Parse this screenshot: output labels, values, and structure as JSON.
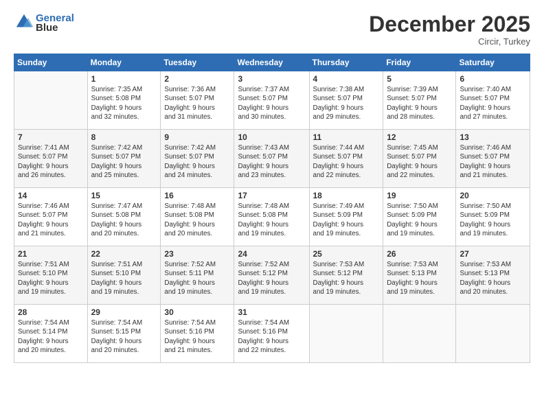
{
  "header": {
    "logo_line1": "General",
    "logo_line2": "Blue",
    "month": "December 2025",
    "location": "Circir, Turkey"
  },
  "weekdays": [
    "Sunday",
    "Monday",
    "Tuesday",
    "Wednesday",
    "Thursday",
    "Friday",
    "Saturday"
  ],
  "weeks": [
    [
      {
        "day": "",
        "info": ""
      },
      {
        "day": "1",
        "info": "Sunrise: 7:35 AM\nSunset: 5:08 PM\nDaylight: 9 hours\nand 32 minutes."
      },
      {
        "day": "2",
        "info": "Sunrise: 7:36 AM\nSunset: 5:07 PM\nDaylight: 9 hours\nand 31 minutes."
      },
      {
        "day": "3",
        "info": "Sunrise: 7:37 AM\nSunset: 5:07 PM\nDaylight: 9 hours\nand 30 minutes."
      },
      {
        "day": "4",
        "info": "Sunrise: 7:38 AM\nSunset: 5:07 PM\nDaylight: 9 hours\nand 29 minutes."
      },
      {
        "day": "5",
        "info": "Sunrise: 7:39 AM\nSunset: 5:07 PM\nDaylight: 9 hours\nand 28 minutes."
      },
      {
        "day": "6",
        "info": "Sunrise: 7:40 AM\nSunset: 5:07 PM\nDaylight: 9 hours\nand 27 minutes."
      }
    ],
    [
      {
        "day": "7",
        "info": "Sunrise: 7:41 AM\nSunset: 5:07 PM\nDaylight: 9 hours\nand 26 minutes."
      },
      {
        "day": "8",
        "info": "Sunrise: 7:42 AM\nSunset: 5:07 PM\nDaylight: 9 hours\nand 25 minutes."
      },
      {
        "day": "9",
        "info": "Sunrise: 7:42 AM\nSunset: 5:07 PM\nDaylight: 9 hours\nand 24 minutes."
      },
      {
        "day": "10",
        "info": "Sunrise: 7:43 AM\nSunset: 5:07 PM\nDaylight: 9 hours\nand 23 minutes."
      },
      {
        "day": "11",
        "info": "Sunrise: 7:44 AM\nSunset: 5:07 PM\nDaylight: 9 hours\nand 22 minutes."
      },
      {
        "day": "12",
        "info": "Sunrise: 7:45 AM\nSunset: 5:07 PM\nDaylight: 9 hours\nand 22 minutes."
      },
      {
        "day": "13",
        "info": "Sunrise: 7:46 AM\nSunset: 5:07 PM\nDaylight: 9 hours\nand 21 minutes."
      }
    ],
    [
      {
        "day": "14",
        "info": "Sunrise: 7:46 AM\nSunset: 5:07 PM\nDaylight: 9 hours\nand 21 minutes."
      },
      {
        "day": "15",
        "info": "Sunrise: 7:47 AM\nSunset: 5:08 PM\nDaylight: 9 hours\nand 20 minutes."
      },
      {
        "day": "16",
        "info": "Sunrise: 7:48 AM\nSunset: 5:08 PM\nDaylight: 9 hours\nand 20 minutes."
      },
      {
        "day": "17",
        "info": "Sunrise: 7:48 AM\nSunset: 5:08 PM\nDaylight: 9 hours\nand 19 minutes."
      },
      {
        "day": "18",
        "info": "Sunrise: 7:49 AM\nSunset: 5:09 PM\nDaylight: 9 hours\nand 19 minutes."
      },
      {
        "day": "19",
        "info": "Sunrise: 7:50 AM\nSunset: 5:09 PM\nDaylight: 9 hours\nand 19 minutes."
      },
      {
        "day": "20",
        "info": "Sunrise: 7:50 AM\nSunset: 5:09 PM\nDaylight: 9 hours\nand 19 minutes."
      }
    ],
    [
      {
        "day": "21",
        "info": "Sunrise: 7:51 AM\nSunset: 5:10 PM\nDaylight: 9 hours\nand 19 minutes."
      },
      {
        "day": "22",
        "info": "Sunrise: 7:51 AM\nSunset: 5:10 PM\nDaylight: 9 hours\nand 19 minutes."
      },
      {
        "day": "23",
        "info": "Sunrise: 7:52 AM\nSunset: 5:11 PM\nDaylight: 9 hours\nand 19 minutes."
      },
      {
        "day": "24",
        "info": "Sunrise: 7:52 AM\nSunset: 5:12 PM\nDaylight: 9 hours\nand 19 minutes."
      },
      {
        "day": "25",
        "info": "Sunrise: 7:53 AM\nSunset: 5:12 PM\nDaylight: 9 hours\nand 19 minutes."
      },
      {
        "day": "26",
        "info": "Sunrise: 7:53 AM\nSunset: 5:13 PM\nDaylight: 9 hours\nand 19 minutes."
      },
      {
        "day": "27",
        "info": "Sunrise: 7:53 AM\nSunset: 5:13 PM\nDaylight: 9 hours\nand 20 minutes."
      }
    ],
    [
      {
        "day": "28",
        "info": "Sunrise: 7:54 AM\nSunset: 5:14 PM\nDaylight: 9 hours\nand 20 minutes."
      },
      {
        "day": "29",
        "info": "Sunrise: 7:54 AM\nSunset: 5:15 PM\nDaylight: 9 hours\nand 20 minutes."
      },
      {
        "day": "30",
        "info": "Sunrise: 7:54 AM\nSunset: 5:16 PM\nDaylight: 9 hours\nand 21 minutes."
      },
      {
        "day": "31",
        "info": "Sunrise: 7:54 AM\nSunset: 5:16 PM\nDaylight: 9 hours\nand 22 minutes."
      },
      {
        "day": "",
        "info": ""
      },
      {
        "day": "",
        "info": ""
      },
      {
        "day": "",
        "info": ""
      }
    ]
  ]
}
